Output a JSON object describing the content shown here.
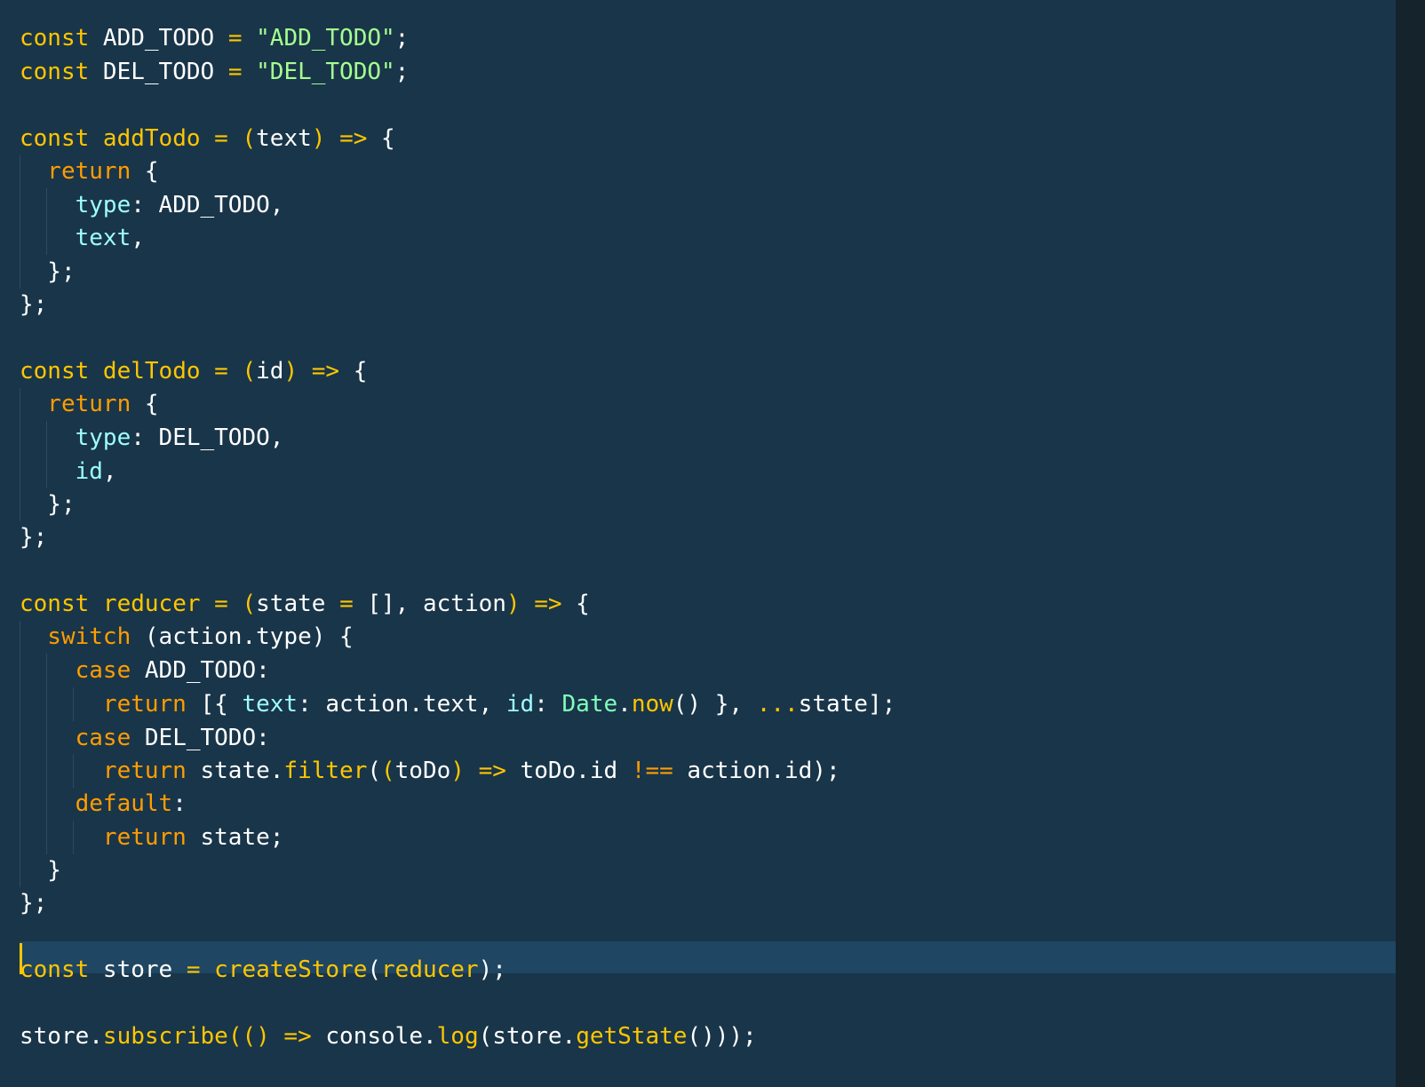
{
  "editor": {
    "language": "javascript",
    "theme_colors": {
      "background": "#193549",
      "keyword": "#ff9d00",
      "const": "#ffc600",
      "string": "#a5ff90",
      "property": "#9effff",
      "function": "#ffc600",
      "class": "#80ffbb",
      "plain": "#ffffff",
      "current_line": "#1f4662",
      "cursor": "#ffc600"
    },
    "lines": [
      [
        [
          "kw2",
          "const"
        ],
        [
          "id",
          " ADD_TODO "
        ],
        [
          "op",
          "="
        ],
        [
          "str",
          " \"ADD_TODO\""
        ],
        [
          "punc",
          ";"
        ]
      ],
      [
        [
          "kw2",
          "const"
        ],
        [
          "id",
          " DEL_TODO "
        ],
        [
          "op",
          "="
        ],
        [
          "str",
          " \"DEL_TODO\""
        ],
        [
          "punc",
          ";"
        ]
      ],
      [],
      [
        [
          "kw2",
          "const"
        ],
        [
          "fn",
          " addTodo"
        ],
        [
          "op",
          " ="
        ],
        [
          "op",
          " ("
        ],
        [
          "id",
          "text"
        ],
        [
          "op",
          ")"
        ],
        [
          "op",
          " =>"
        ],
        [
          "punc",
          " {"
        ]
      ],
      [
        [
          "kw",
          "  return"
        ],
        [
          "punc",
          " {"
        ]
      ],
      [
        [
          "prop",
          "    type"
        ],
        [
          "punc",
          ": ADD_TODO,"
        ]
      ],
      [
        [
          "prop",
          "    text"
        ],
        [
          "punc",
          ","
        ]
      ],
      [
        [
          "punc",
          "  };"
        ]
      ],
      [
        [
          "punc",
          "};"
        ]
      ],
      [],
      [
        [
          "kw2",
          "const"
        ],
        [
          "fn",
          " delTodo"
        ],
        [
          "op",
          " ="
        ],
        [
          "op",
          " ("
        ],
        [
          "id",
          "id"
        ],
        [
          "op",
          ")"
        ],
        [
          "op",
          " =>"
        ],
        [
          "punc",
          " {"
        ]
      ],
      [
        [
          "kw",
          "  return"
        ],
        [
          "punc",
          " {"
        ]
      ],
      [
        [
          "prop",
          "    type"
        ],
        [
          "punc",
          ": DEL_TODO,"
        ]
      ],
      [
        [
          "prop",
          "    id"
        ],
        [
          "punc",
          ","
        ]
      ],
      [
        [
          "punc",
          "  };"
        ]
      ],
      [
        [
          "punc",
          "};"
        ]
      ],
      [],
      [
        [
          "kw2",
          "const"
        ],
        [
          "fn",
          " reducer"
        ],
        [
          "op",
          " ="
        ],
        [
          "op",
          " ("
        ],
        [
          "id",
          "state "
        ],
        [
          "op",
          "="
        ],
        [
          "punc",
          " [], action"
        ],
        [
          "op",
          ")"
        ],
        [
          "op",
          " =>"
        ],
        [
          "punc",
          " {"
        ]
      ],
      [
        [
          "kw",
          "  switch"
        ],
        [
          "punc",
          " (action.type) {"
        ]
      ],
      [
        [
          "kw",
          "    case"
        ],
        [
          "punc",
          " ADD_TODO:"
        ]
      ],
      [
        [
          "kw",
          "      return"
        ],
        [
          "punc",
          " [{ "
        ],
        [
          "prop",
          "text"
        ],
        [
          "punc",
          ": action.text, "
        ],
        [
          "prop",
          "id"
        ],
        [
          "punc",
          ": "
        ],
        [
          "cls",
          "Date"
        ],
        [
          "punc",
          "."
        ],
        [
          "fn",
          "now"
        ],
        [
          "punc",
          "() }, "
        ],
        [
          "op",
          "..."
        ],
        [
          "punc",
          "state];"
        ]
      ],
      [
        [
          "kw",
          "    case"
        ],
        [
          "punc",
          " DEL_TODO:"
        ]
      ],
      [
        [
          "kw",
          "      return"
        ],
        [
          "punc",
          " state."
        ],
        [
          "fn",
          "filter"
        ],
        [
          "punc",
          "("
        ],
        [
          "op",
          "("
        ],
        [
          "id",
          "toDo"
        ],
        [
          "op",
          ")"
        ],
        [
          "op",
          " =>"
        ],
        [
          "punc",
          " toDo.id "
        ],
        [
          "kw",
          "!=="
        ],
        [
          "punc",
          " action.id);"
        ]
      ],
      [
        [
          "kw",
          "    default"
        ],
        [
          "punc",
          ":"
        ]
      ],
      [
        [
          "kw",
          "      return"
        ],
        [
          "punc",
          " state;"
        ]
      ],
      [
        [
          "punc",
          "  }"
        ]
      ],
      [
        [
          "punc",
          "};"
        ]
      ],
      [],
      [
        [
          "kw2",
          "const"
        ],
        [
          "id",
          " store "
        ],
        [
          "op",
          "="
        ],
        [
          "fn",
          " createStore"
        ],
        [
          "punc",
          "("
        ],
        [
          "fn",
          "reducer"
        ],
        [
          "punc",
          ");"
        ]
      ],
      [],
      [
        [
          "id",
          "store."
        ],
        [
          "fn",
          "subscribe"
        ],
        [
          "op",
          "(()"
        ],
        [
          "op",
          " =>"
        ],
        [
          "punc",
          " console."
        ],
        [
          "fn",
          "log"
        ],
        [
          "punc",
          "(store."
        ],
        [
          "fn",
          "getState"
        ],
        [
          "punc",
          "()));"
        ]
      ]
    ]
  }
}
